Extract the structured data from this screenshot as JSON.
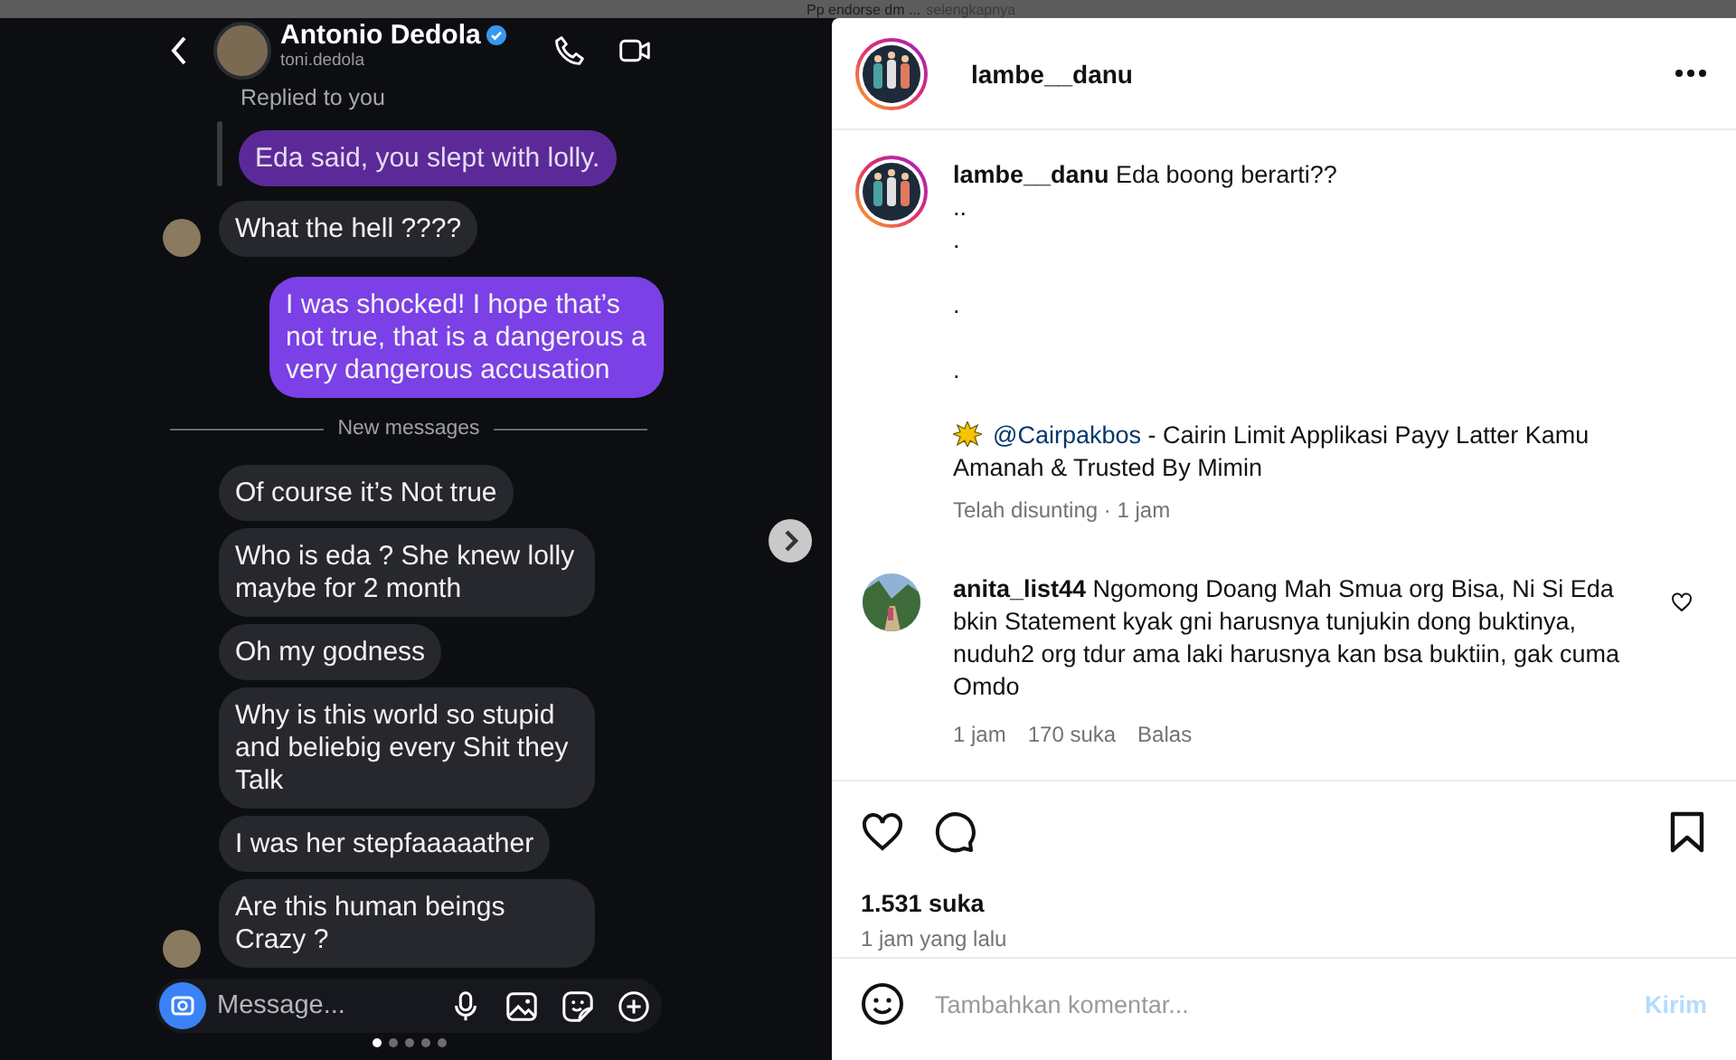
{
  "caption_peek": {
    "text": "Pp endorse dm ...",
    "more": "selengkapnya"
  },
  "chat": {
    "contact": {
      "name": "Antonio Dedola",
      "handle": "toni.dedola",
      "verified": true
    },
    "reply_label": "Replied to you",
    "messages": [
      {
        "kind": "quote",
        "text": "Eda said, you slept with lolly."
      },
      {
        "kind": "received",
        "text": "What the hell ????",
        "avatar": true
      },
      {
        "kind": "sent",
        "text": "I was shocked! I hope that’s not true, that is a dangerous a very dangerous accusation"
      },
      {
        "kind": "divider",
        "text": "New messages"
      },
      {
        "kind": "received",
        "text": "Of course it’s Not true",
        "avatar": false
      },
      {
        "kind": "received",
        "text": "Who is eda ? She knew lolly maybe for 2 month",
        "avatar": false
      },
      {
        "kind": "received",
        "text": "Oh my godness",
        "avatar": false
      },
      {
        "kind": "received",
        "text": "Why is this world so stupid and beliebig every Shit they Talk",
        "avatar": false
      },
      {
        "kind": "received",
        "text": "I was her stepfaaaaather",
        "avatar": false
      },
      {
        "kind": "received",
        "text": "Are this human beings Crazy ?",
        "avatar": true
      }
    ],
    "composer": {
      "placeholder": "Message..."
    }
  },
  "carousel_dots": [
    {
      "selected": true
    },
    {
      "selected": false
    },
    {
      "selected": false
    },
    {
      "selected": false
    },
    {
      "selected": false
    }
  ],
  "post": {
    "author": "lambe__danu",
    "caption": {
      "author": "lambe__danu",
      "text": "Eda boong berarti??",
      "lines": [
        {
          "text": "..",
          "spaced": false
        },
        {
          "text": ".",
          "spaced": false
        },
        {
          "text": ".",
          "spaced": true
        },
        {
          "text": ".",
          "spaced": true
        }
      ],
      "mention": "@Cairpakbos",
      "promo": " - Cairin Limit Applikasi Payy Latter Kamu Amanah & Trusted By Mimin",
      "meta": "Telah disunting · 1 jam"
    },
    "comments": [
      {
        "user": "anita_list44",
        "text": "Ngomong Doang Mah Smua org Bisa, Ni Si Eda bkin Statement kyak gni harusnya tunjukin dong buktinya, nuduh2 org tdur ama laki harusnya kan bsa buktiin, gak cuma Omdo",
        "time": "1 jam",
        "likes": "170 suka",
        "reply": "Balas"
      }
    ],
    "likes": "1.531 suka",
    "posted": "1 jam yang lalu",
    "comment_box": {
      "placeholder": "Tambahkan komentar...",
      "submit": "Kirim"
    }
  }
}
